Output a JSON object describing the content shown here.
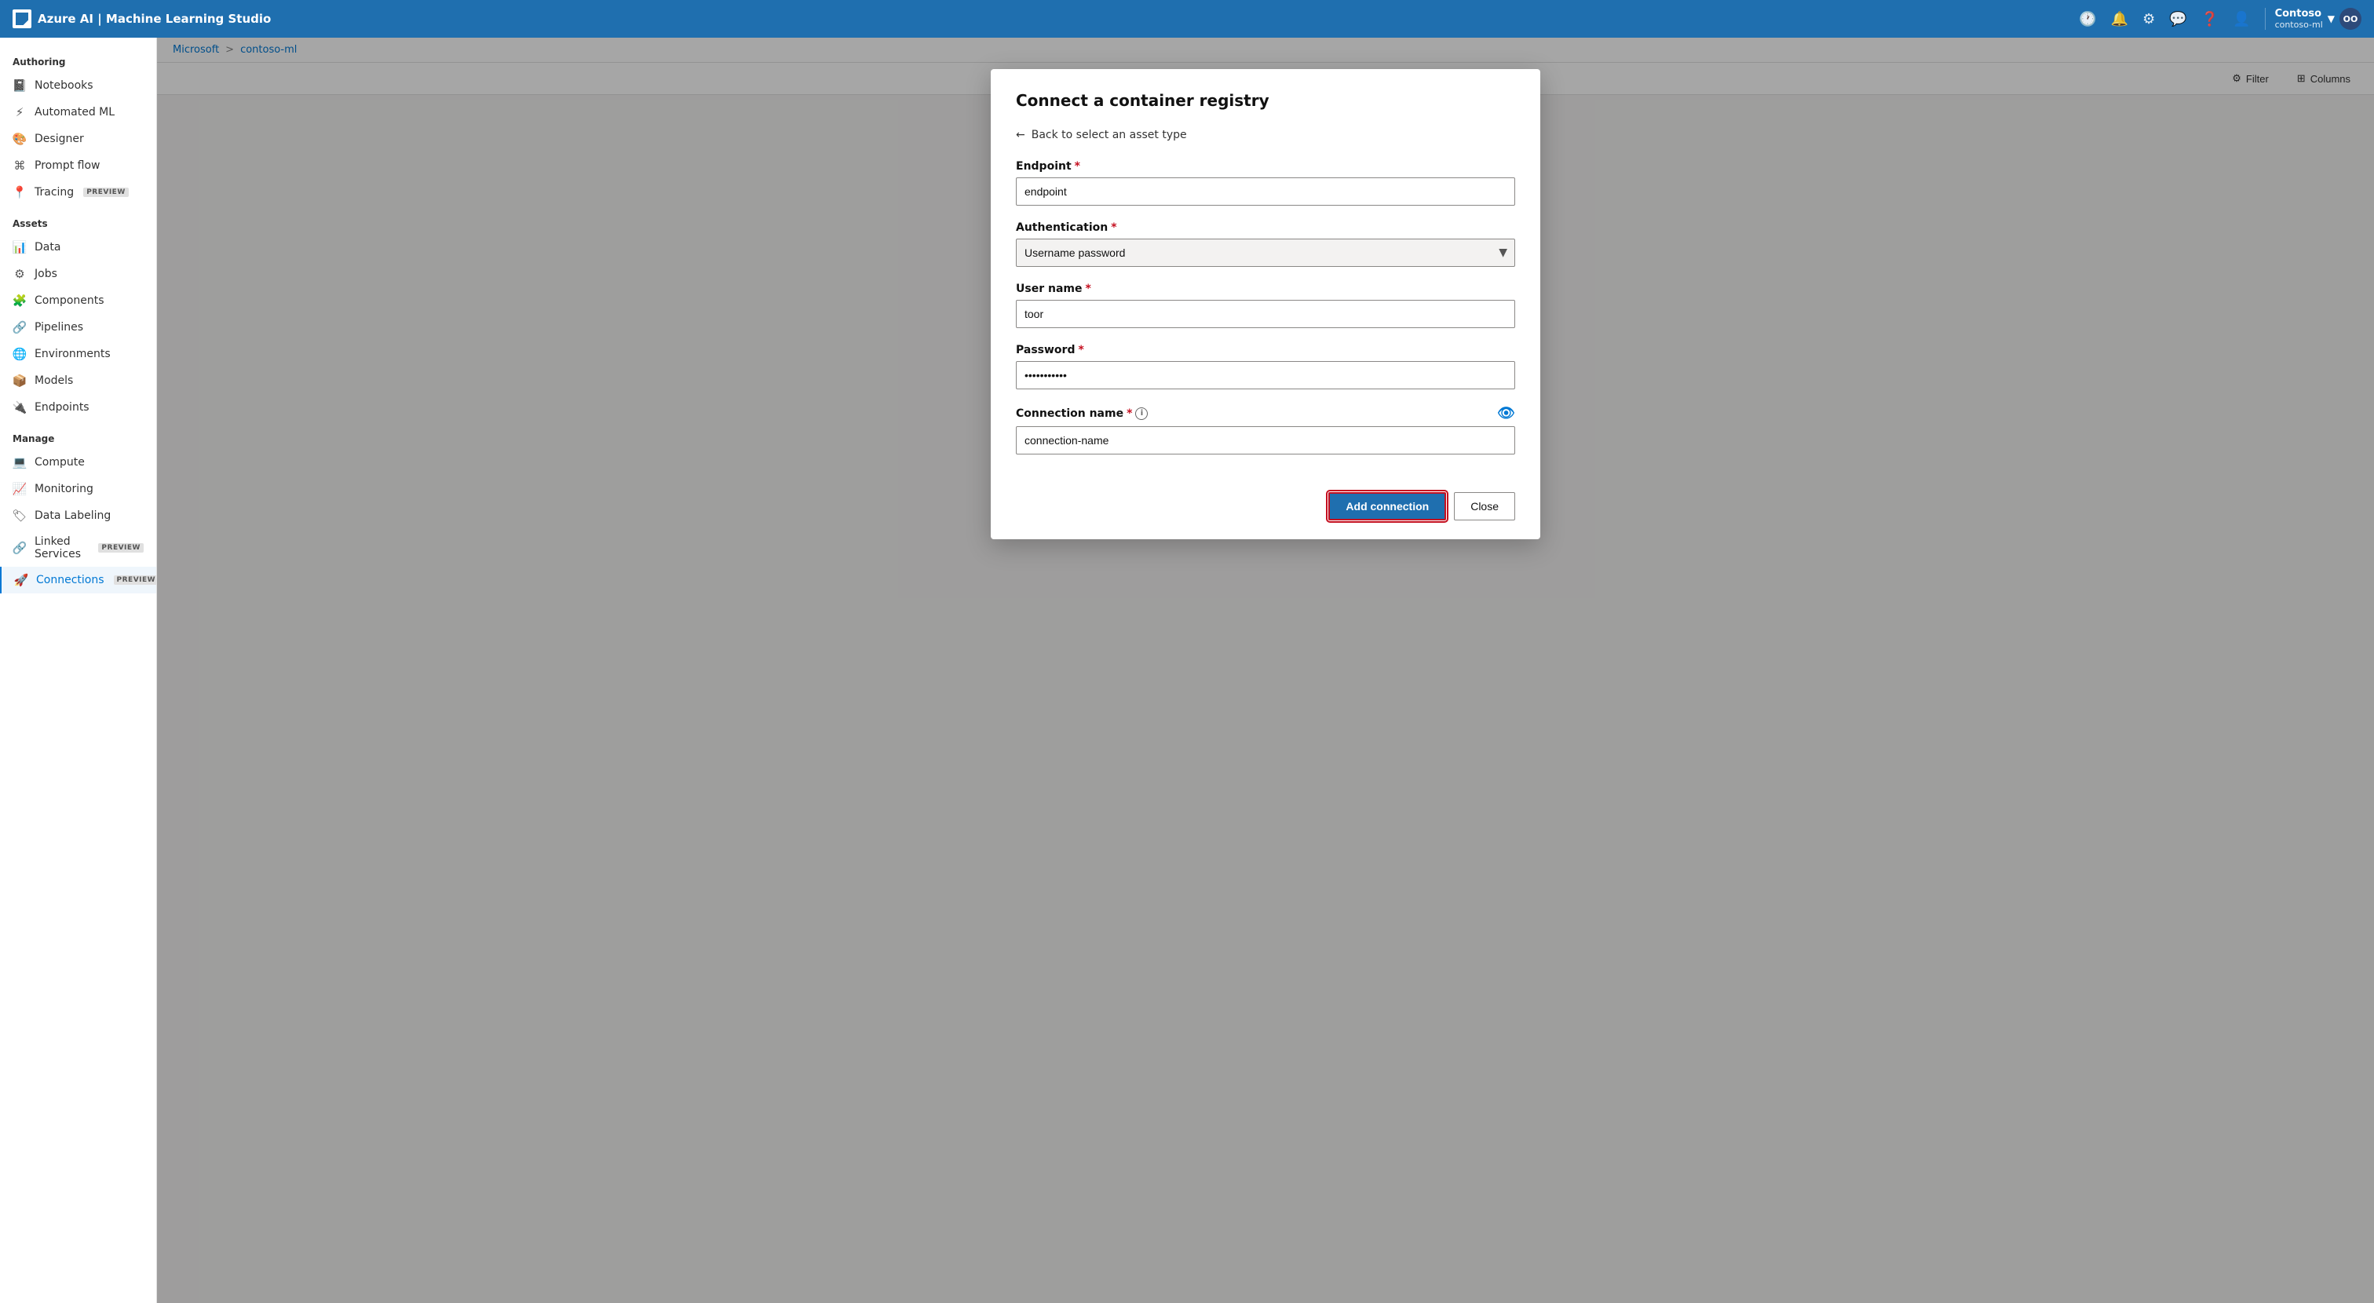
{
  "app": {
    "title": "Azure AI | Machine Learning Studio",
    "logo_initials": "OO"
  },
  "header": {
    "title": "Azure AI | Machine Learning Studio",
    "user_name": "Contoso",
    "user_workspace": "contoso-ml",
    "avatar_initials": "OO",
    "icons": [
      "history",
      "bell",
      "settings",
      "chat",
      "help",
      "account"
    ]
  },
  "breadcrumb": {
    "items": [
      "Microsoft",
      "contoso-ml"
    ],
    "separator": ">"
  },
  "sidebar": {
    "authoring_label": "Authoring",
    "assets_label": "Assets",
    "manage_label": "Manage",
    "items": [
      {
        "id": "notebooks",
        "label": "Notebooks",
        "icon": "📓"
      },
      {
        "id": "automated-ml",
        "label": "Automated ML",
        "icon": "⚡"
      },
      {
        "id": "designer",
        "label": "Designer",
        "icon": "🎨"
      },
      {
        "id": "prompt-flow",
        "label": "Prompt flow",
        "icon": "⌘"
      },
      {
        "id": "tracing",
        "label": "Tracing",
        "icon": "📍",
        "badge": "PREVIEW"
      },
      {
        "id": "data",
        "label": "Data",
        "icon": "📊"
      },
      {
        "id": "jobs",
        "label": "Jobs",
        "icon": "⚙"
      },
      {
        "id": "components",
        "label": "Components",
        "icon": "🧩"
      },
      {
        "id": "pipelines",
        "label": "Pipelines",
        "icon": "🔗"
      },
      {
        "id": "environments",
        "label": "Environments",
        "icon": "🌐"
      },
      {
        "id": "models",
        "label": "Models",
        "icon": "📦"
      },
      {
        "id": "endpoints",
        "label": "Endpoints",
        "icon": "🔌"
      },
      {
        "id": "compute",
        "label": "Compute",
        "icon": "💻"
      },
      {
        "id": "monitoring",
        "label": "Monitoring",
        "icon": "📈"
      },
      {
        "id": "data-labeling",
        "label": "Data Labeling",
        "icon": "🏷"
      },
      {
        "id": "linked-services",
        "label": "Linked Services",
        "icon": "🔗",
        "badge": "PREVIEW"
      },
      {
        "id": "connections",
        "label": "Connections",
        "icon": "🚀",
        "badge": "PREVIEW",
        "active": true
      }
    ]
  },
  "bg_toolbar": {
    "filter_label": "Filter",
    "columns_label": "Columns"
  },
  "modal": {
    "title": "Connect a container registry",
    "back_label": "Back to select an asset type",
    "endpoint_label": "Endpoint",
    "endpoint_value": "endpoint",
    "authentication_label": "Authentication",
    "authentication_value": "Username password",
    "username_label": "User name",
    "username_value": "toor",
    "password_label": "Password",
    "password_value": "••••••••",
    "connection_name_label": "Connection name",
    "connection_name_value": "connection-name",
    "add_connection_label": "Add connection",
    "close_label": "Close"
  }
}
